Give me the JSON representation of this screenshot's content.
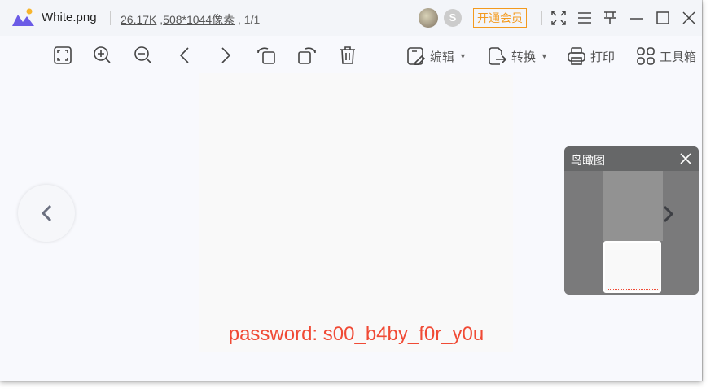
{
  "title": {
    "filename": "White.png",
    "size": "26.17K",
    "dimensions": "508*1044像素",
    "page": "1/1",
    "vip_label": "开通会员"
  },
  "toolbar": {
    "edit": "编辑",
    "convert": "转换",
    "print": "打印",
    "tools": "工具箱"
  },
  "image": {
    "text": "password: s00_b4by_f0r_y0u"
  },
  "birdseye": {
    "title": "鸟瞰图"
  }
}
